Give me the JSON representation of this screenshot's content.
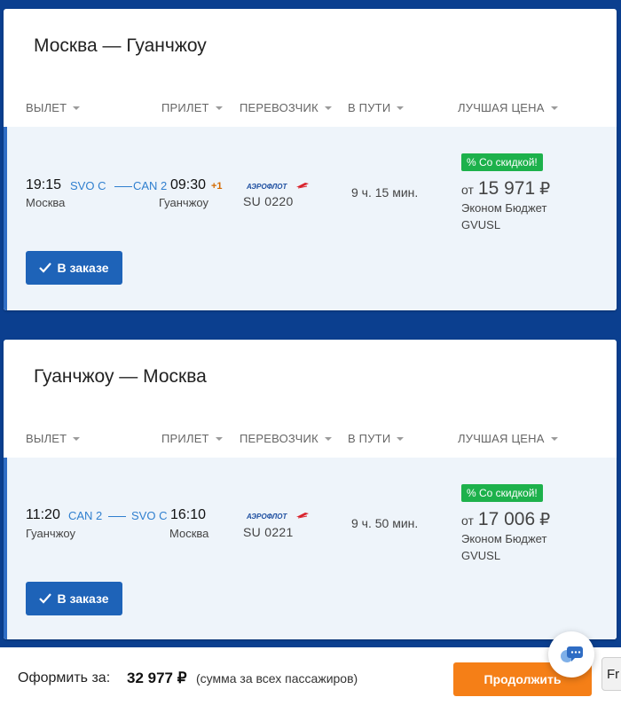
{
  "columns": {
    "departure": "ВЫЛЕТ",
    "arrival": "ПРИЛЕТ",
    "carrier": "ПЕРЕВОЗЧИК",
    "duration": "В ПУТИ",
    "best_price": "ЛУЧШАЯ ЦЕНА"
  },
  "segments": [
    {
      "title": "Москва — Гуанчжоу",
      "dep_time": "19:15",
      "dep_airport": "SVO C",
      "dep_city": "Москва",
      "arr_airport": "CAN 2",
      "arr_time": "09:30",
      "day_shift": "+1",
      "arr_city": "Гуанчжоу",
      "carrier_logo_text": "АЭРОФЛОТ",
      "flight_no": "SU 0220",
      "duration": "9 ч. 15 мин.",
      "discount_badge": "% Со скидкой!",
      "price_from": "от",
      "price": "15 971",
      "currency": "₽",
      "fare_name": "Эконом Бюджет",
      "fare_code": "GVUSL",
      "order_button": "В заказе"
    },
    {
      "title": "Гуанчжоу — Москва",
      "dep_time": "11:20",
      "dep_airport": "CAN 2",
      "dep_city": "Гуанчжоу",
      "arr_airport": "SVO C",
      "arr_time": "16:10",
      "day_shift": "",
      "arr_city": "Москва",
      "carrier_logo_text": "АЭРОФЛОТ",
      "flight_no": "SU 0221",
      "duration": "9 ч. 50 мин.",
      "discount_badge": "% Со скидкой!",
      "price_from": "от",
      "price": "17 006",
      "currency": "₽",
      "fare_name": "Эконом Бюджет",
      "fare_code": "GVUSL",
      "order_button": "В заказе"
    }
  ],
  "footer": {
    "label": "Оформить за:",
    "total": "32 977 ₽",
    "note": "(сумма за всех пассажиров)",
    "continue_button": "Продолжить"
  },
  "language_tab": "Fr",
  "colors": {
    "page_bg": "#0b3f8f",
    "row_bg": "#eef4fa",
    "accent_blue": "#1e63b8",
    "discount_green": "#1db14b",
    "continue_orange": "#f57f17"
  }
}
